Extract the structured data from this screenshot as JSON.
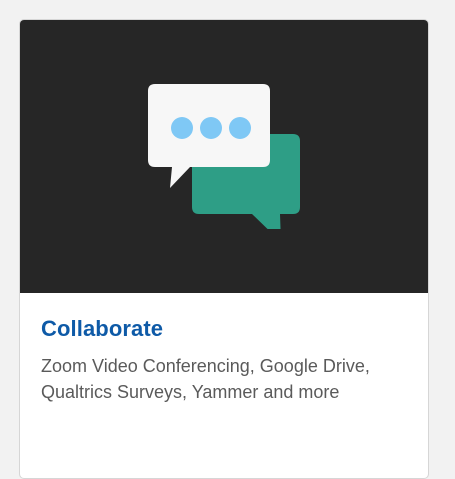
{
  "card": {
    "title": "Collaborate",
    "description": "Zoom Video Conferencing, Google Drive, Qualtrics Surveys, Yammer and more",
    "icon": "chat-bubbles-icon"
  },
  "colors": {
    "hero_background": "#262626",
    "title_blue": "#0e5aa7",
    "bubble_white": "#f7f7f7",
    "bubble_green": "#2e9e86",
    "dot_blue": "#7fc8f5"
  }
}
